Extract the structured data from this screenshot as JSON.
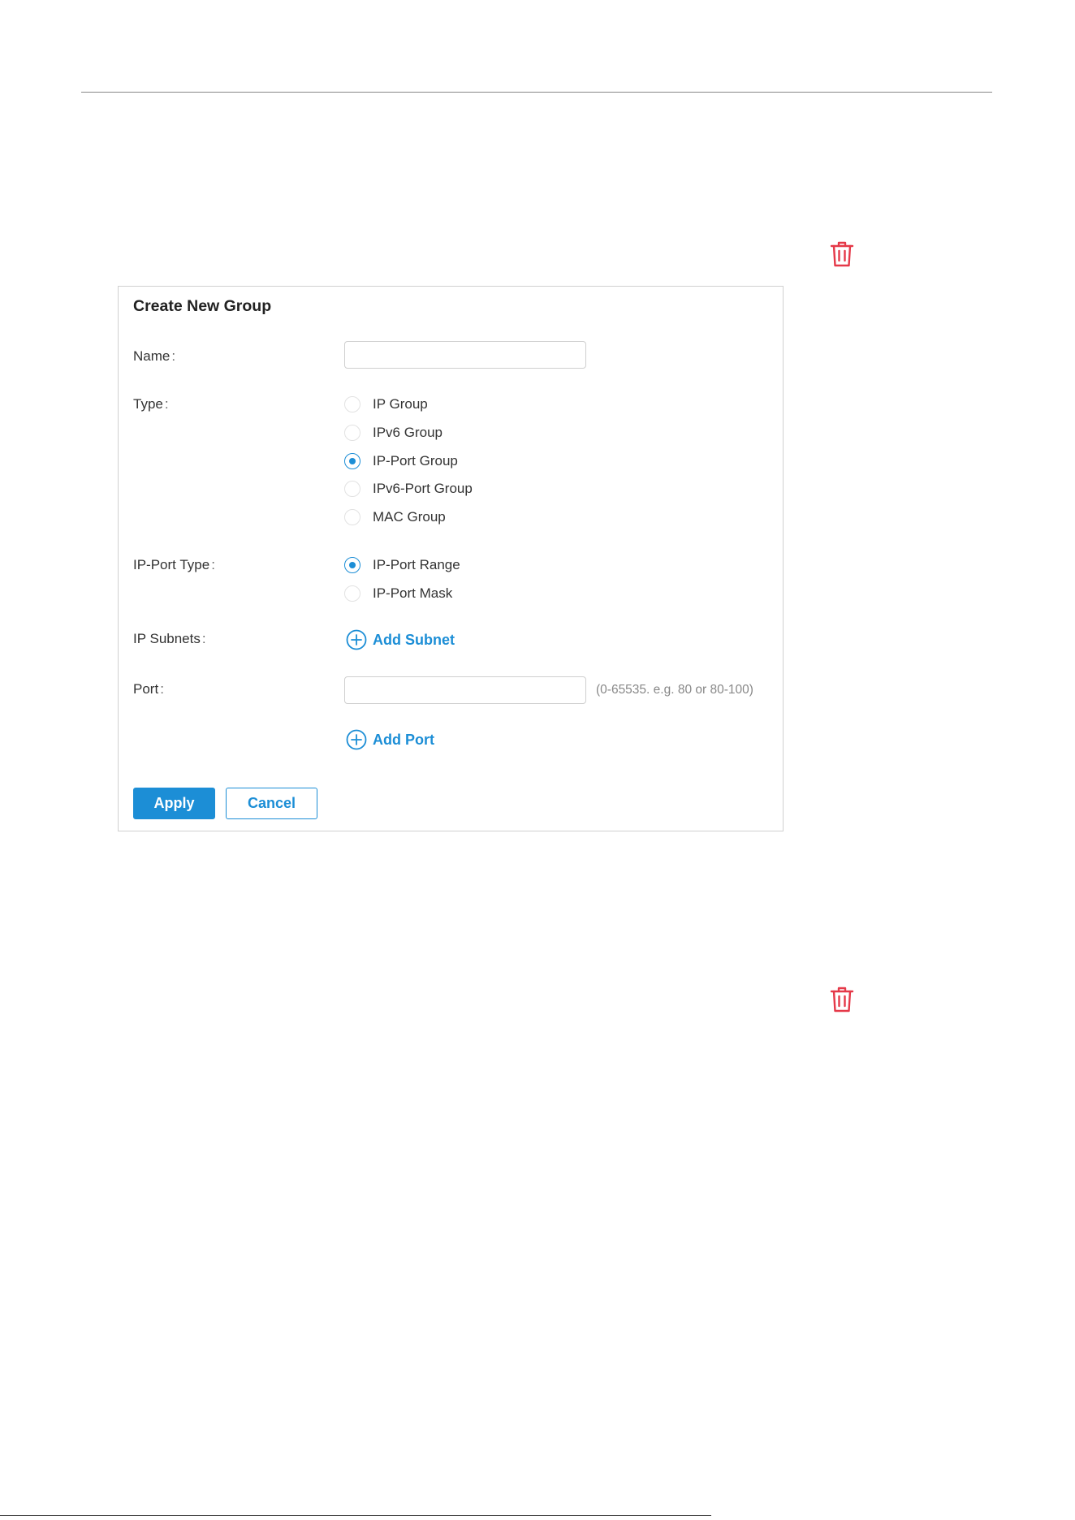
{
  "page": {
    "trash_icon": "trash-icon",
    "accent_color": "#1c8ed6",
    "delete_color": "#e53949"
  },
  "form": {
    "title": "Create New Group",
    "name": {
      "label": "Name",
      "colon": ":",
      "value": "",
      "placeholder": ""
    },
    "type": {
      "label": "Type",
      "colon": ":",
      "options": [
        {
          "label": "IP Group",
          "checked": false
        },
        {
          "label": "IPv6 Group",
          "checked": false
        },
        {
          "label": "IP-Port Group",
          "checked": true
        },
        {
          "label": "IPv6-Port Group",
          "checked": false
        },
        {
          "label": "MAC Group",
          "checked": false
        }
      ]
    },
    "ip_port_type": {
      "label": "IP-Port Type",
      "colon": ":",
      "options": [
        {
          "label": "IP-Port Range",
          "checked": true
        },
        {
          "label": "IP-Port Mask",
          "checked": false
        }
      ]
    },
    "ip_subnets": {
      "label": "IP Subnets",
      "colon": ":",
      "add_label": "Add Subnet",
      "icon": "plus-circle-icon"
    },
    "port": {
      "label": "Port",
      "colon": ":",
      "value": "",
      "hint": "(0-65535. e.g. 80 or 80-100)",
      "add_label": "Add Port",
      "icon": "plus-circle-icon"
    },
    "buttons": {
      "apply": "Apply",
      "cancel": "Cancel"
    }
  }
}
